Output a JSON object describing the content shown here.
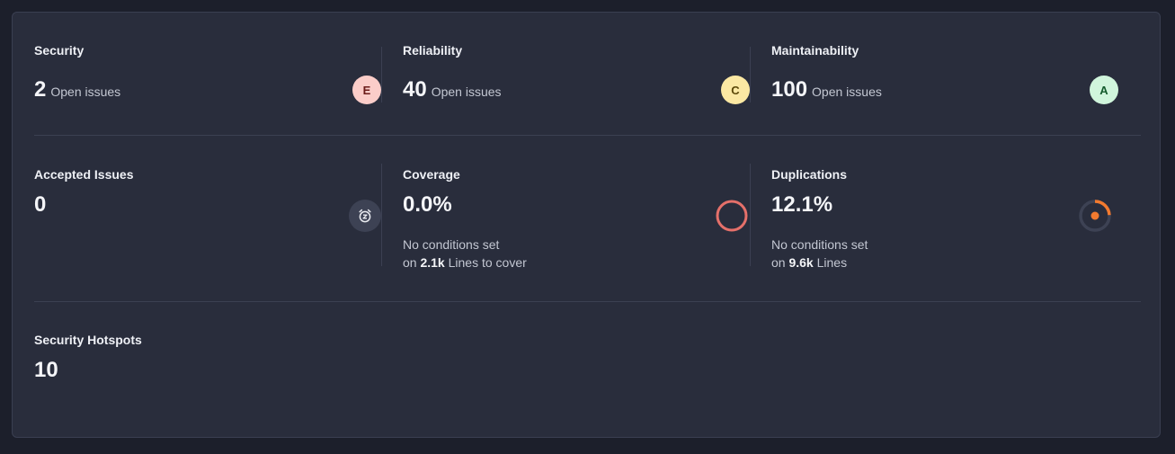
{
  "security": {
    "title": "Security",
    "value": "2",
    "unit": "Open issues",
    "rating": "E"
  },
  "reliability": {
    "title": "Reliability",
    "value": "40",
    "unit": "Open issues",
    "rating": "C"
  },
  "maintainability": {
    "title": "Maintainability",
    "value": "100",
    "unit": "Open issues",
    "rating": "A"
  },
  "accepted": {
    "title": "Accepted Issues",
    "value": "0",
    "icon": "alarm-clock-icon"
  },
  "coverage": {
    "title": "Coverage",
    "value": "0.0%",
    "line1": "No conditions set",
    "line2_pre": "on",
    "line2_num": "2.1k",
    "line2_post": "Lines to cover",
    "ring_fraction": 0.0,
    "ring_color": "#e5706a"
  },
  "duplications": {
    "title": "Duplications",
    "value": "12.1%",
    "line1": "No conditions set",
    "line2_pre": "on",
    "line2_num": "9.6k",
    "line2_post": "Lines",
    "fraction": 0.121,
    "accent": "#f27a2f"
  },
  "hotspots": {
    "title": "Security Hotspots",
    "value": "10"
  }
}
